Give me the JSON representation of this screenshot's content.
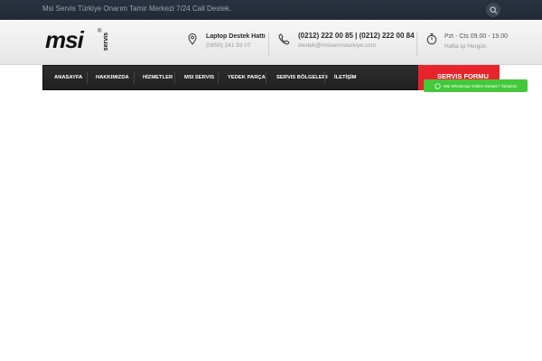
{
  "topbar": {
    "text": "Msi Servis Türkiye Onarım Tamir Merkezi 7/24 Call Destek."
  },
  "logo": {
    "brand": "msi",
    "reg": "®",
    "sub": "servis"
  },
  "header": {
    "support": {
      "title": "Laptop Destek Hattı",
      "phone": "(0850) 241 93 07"
    },
    "phones": {
      "title": "(0212) 222 00 85 | (0212) 222 00 84",
      "email": "destek@msiservisturkiye.com"
    },
    "hours": {
      "title": "Pzt - Cts 09.00 - 19.00",
      "sub": "Hafta içi Hergün"
    }
  },
  "nav": {
    "items": [
      "ANASAYFA",
      "HAKKIMIZDA",
      "HİZMETLER",
      "MSI SERVIS",
      "YEDEK PARÇA",
      "SERVIS BÖLGELERI",
      "İLETİŞİM"
    ]
  },
  "cta": {
    "label": "SERVIS FORMU"
  },
  "whatsapp": {
    "label": "Msi WhatsApp Online Destek / Talepiniz"
  },
  "colors": {
    "accent": "#e8242b",
    "whatsapp": "#43c83a",
    "topbar": "#252c38"
  }
}
